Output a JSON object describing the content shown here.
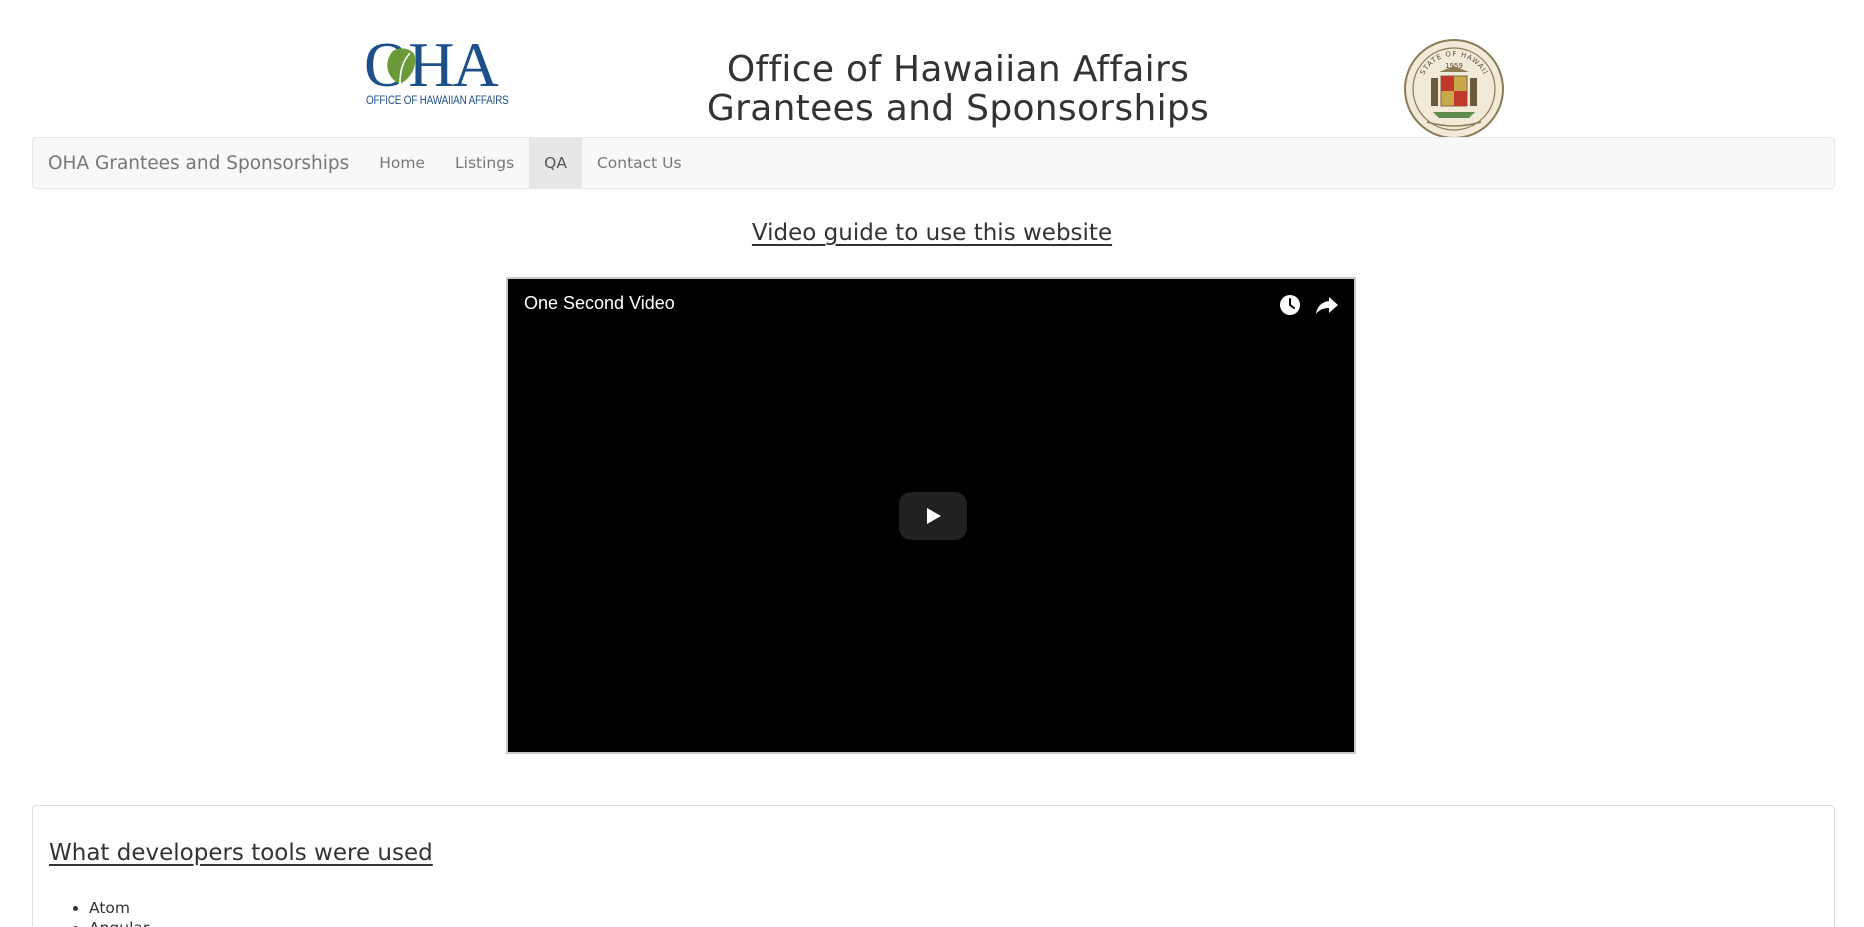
{
  "header": {
    "logo": {
      "letters": "OHA",
      "subtitle": "OFFICE OF HAWAIIAN AFFAIRS"
    },
    "title_line1": "Office of Hawaiian Affairs",
    "title_line2": "Grantees and Sponsorships",
    "seal": {
      "top_text": "STATE OF HAWAII",
      "year": "1959"
    }
  },
  "navbar": {
    "brand": "OHA Grantees and Sponsorships",
    "items": [
      {
        "label": "Home",
        "active": false
      },
      {
        "label": "Listings",
        "active": false
      },
      {
        "label": "QA",
        "active": true
      },
      {
        "label": "Contact Us",
        "active": false
      }
    ]
  },
  "video": {
    "heading": "Video guide to use this website",
    "title": "One Second Video",
    "icons": {
      "watch_later": "clock-icon",
      "share": "share-icon",
      "play": "play-icon"
    }
  },
  "panel": {
    "heading": "What developers tools were used",
    "tools": [
      "Atom",
      "Angular"
    ]
  },
  "colors": {
    "brand_blue": "#1d4f8a",
    "leaf_green": "#6a9a3a",
    "navbar_bg": "#f8f8f8",
    "active_nav_bg": "#e7e7e7",
    "video_bg": "#000000"
  }
}
